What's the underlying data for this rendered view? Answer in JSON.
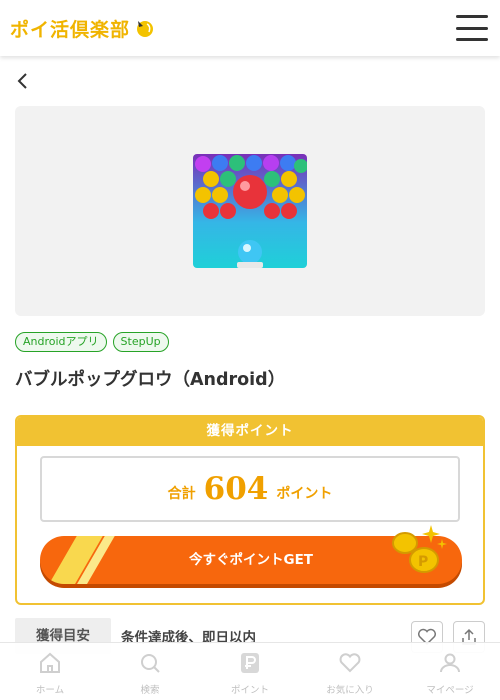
{
  "header": {
    "logo_text": "ポイ活倶楽部",
    "logo_icon": "sparkle-coin-icon",
    "menu_icon": "hamburger-menu-icon"
  },
  "nav": {
    "back_icon": "chevron-left-icon"
  },
  "offer": {
    "app_icon": "bubble-pop-app-icon",
    "tags": [
      "Androidアプリ",
      "StepUp"
    ],
    "title": "バブルポップグロウ（Android）"
  },
  "points": {
    "header": "獲得ポイント",
    "total_label": "合計",
    "total_value": "604",
    "unit": "ポイント",
    "cta": "今すぐポイントGET"
  },
  "reward_timing": {
    "label": "獲得目安",
    "value": "条件達成後、即日以内"
  },
  "actions": {
    "favorite_icon": "heart-icon",
    "share_icon": "share-icon"
  },
  "tabbar": {
    "items": [
      {
        "label": "ホーム",
        "icon": "home-icon"
      },
      {
        "label": "検索",
        "icon": "search-icon"
      },
      {
        "label": "ポイント",
        "icon": "point-p-icon"
      },
      {
        "label": "お気に入り",
        "icon": "heart-icon"
      },
      {
        "label": "マイページ",
        "icon": "user-icon"
      }
    ]
  },
  "colors": {
    "accent_yellow": "#f1c232",
    "cta_orange": "#f7670d",
    "tag_green": "#27a327",
    "point_text": "#f0a000"
  }
}
